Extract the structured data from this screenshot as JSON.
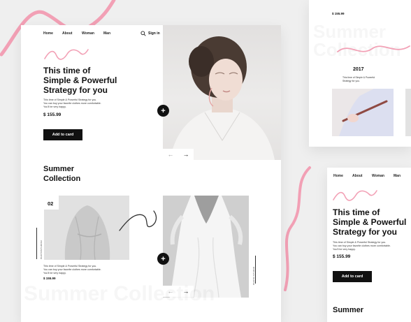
{
  "nav": {
    "items": [
      "Home",
      "About",
      "Woman",
      "Man"
    ],
    "sign_in": "Sign in"
  },
  "hero": {
    "title_line1": "This time of",
    "title_line2": "Simple & Powerful",
    "title_line3": "Strategy for you",
    "desc_line1": "This time of Simple & Powerful Strategy for you.",
    "desc_line2": "You can buy your favorite clothes more comfortable.",
    "desc_line3": "You'll be very happy.",
    "price": "$ 155.99",
    "cta": "Add to card"
  },
  "collection": {
    "title_line1": "Summer",
    "title_line2": "Collection",
    "number": "02",
    "vertical_label": "PHOTOSTUDIO2",
    "vertical_label2": "PHOTO STUDIO",
    "desc_line1": "This time of Simple & Powerful Strategy for you.",
    "desc_line2": "You can buy your favorite clothes more comfortable.",
    "desc_line3": "You'll be very happy.",
    "price": "$ 155.99",
    "watermark": "Summer Collection"
  },
  "right_top": {
    "price": "$ 155.99",
    "watermark_line1": "Summer",
    "watermark_line2": "Collection",
    "year": "2017",
    "desc_line1": "This time of Simple & Powerful",
    "desc_line2": "Strategy for you."
  },
  "right_bottom": {
    "nav": [
      "Home",
      "About",
      "Woman",
      "Man"
    ],
    "title_line1": "This time of",
    "title_line2": "Simple & Powerful",
    "title_line3": "Strategy for you",
    "desc_line1": "This time of Simple & Powerful Strategy for you.",
    "desc_line2": "You can buy your favorite clothes more comfortable.",
    "desc_line3": "You'll be very happy.",
    "price": "$ 155.99",
    "cta": "Add to card",
    "footer": "Summer"
  },
  "icons": {
    "search": "search-icon",
    "plus": "plus-icon",
    "arrow_left": "arrow-left-icon",
    "arrow_right": "arrow-right-icon"
  },
  "colors": {
    "accent_squiggle": "#f2a0b5",
    "button": "#111111",
    "background": "#efefef"
  }
}
